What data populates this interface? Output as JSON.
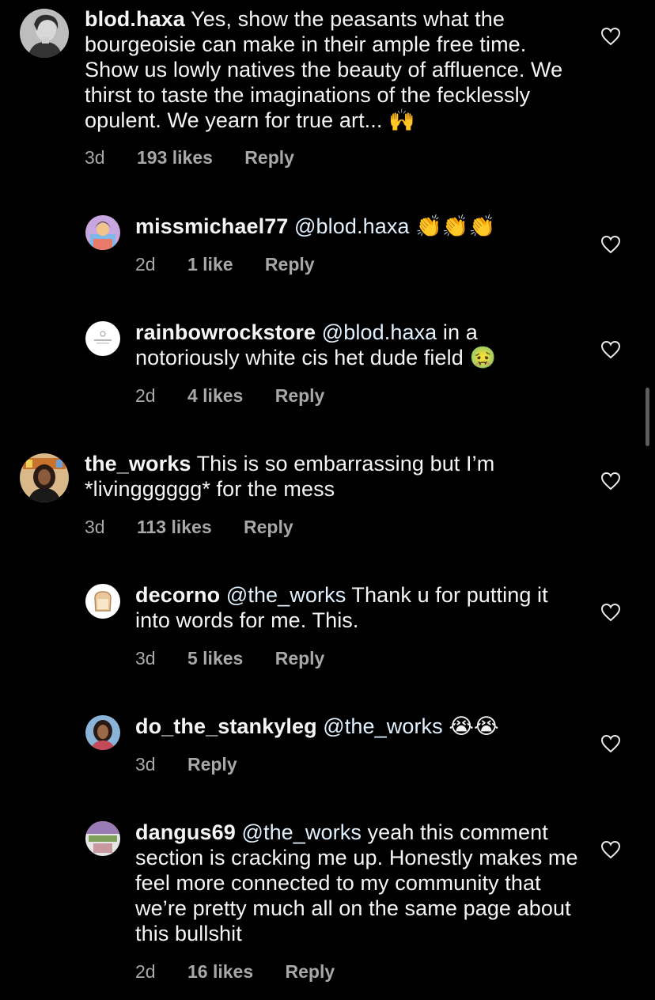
{
  "comments": [
    {
      "username": "blod.haxa",
      "mention": "",
      "text": "Yes, show the peasants what the bourgeoisie can make in their ample free time. Show us lowly natives the beauty of affluence. We thirst to taste the imaginations of the fecklessly opulent. We yearn for true art...",
      "emoji": "🙌",
      "time": "3d",
      "likes": "193 likes",
      "reply": "Reply",
      "avatar_icon": "woman-portrait-avatar"
    },
    {
      "username": "missmichael77",
      "mention": "@blod.haxa",
      "text": "",
      "emoji": "👏👏👏",
      "time": "2d",
      "likes": "1 like",
      "reply": "Reply",
      "avatar_icon": "cartoon-avatar"
    },
    {
      "username": "rainbowrockstore",
      "mention": "@blod.haxa",
      "text": "in a notoriously white cis het dude field",
      "emoji": "🤢",
      "time": "2d",
      "likes": "4 likes",
      "reply": "Reply",
      "avatar_icon": "store-logo-avatar"
    },
    {
      "username": "the_works",
      "mention": "",
      "text": "This is so embarrassing but I’m *livingggggg* for the mess",
      "emoji": "",
      "time": "3d",
      "likes": "113 likes",
      "reply": "Reply",
      "avatar_icon": "person-portrait-avatar"
    },
    {
      "username": "decorno",
      "mention": "@the_works",
      "text": "Thank u for putting it into words for me. This.",
      "emoji": "",
      "time": "3d",
      "likes": "5 likes",
      "reply": "Reply",
      "avatar_icon": "bread-avatar"
    },
    {
      "username": "do_the_stankyleg",
      "mention": "@the_works",
      "text": "",
      "emoji": "😭😭",
      "time": "3d",
      "likes": "",
      "reply": "Reply",
      "avatar_icon": "person-portrait-avatar"
    },
    {
      "username": "dangus69",
      "mention": "@the_works",
      "text": "yeah this comment section is cracking me up. Honestly makes me feel more connected to my community that we’re pretty much all on the same page about this bullshit",
      "emoji": "",
      "time": "2d",
      "likes": "16 likes",
      "reply": "Reply",
      "avatar_icon": "meme-avatar"
    }
  ],
  "colors": {
    "background": "#000000",
    "text": "#f5f5f5",
    "meta": "#a8a8a8",
    "mention": "#e0f1ff"
  },
  "icons": {
    "like": "heart-outline-icon"
  }
}
